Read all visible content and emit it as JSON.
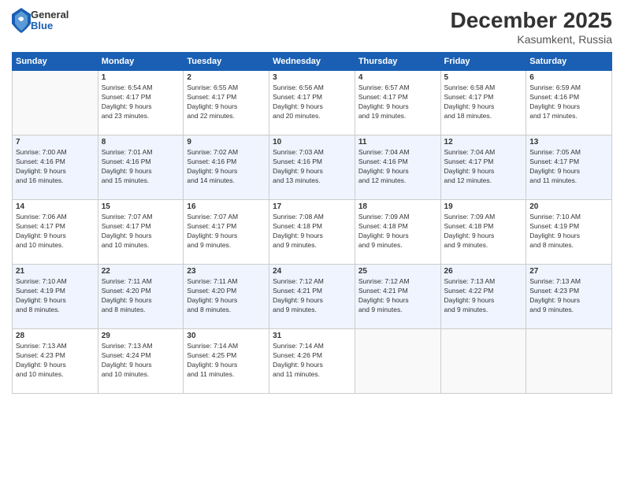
{
  "header": {
    "logo": {
      "line1": "General",
      "line2": "Blue"
    },
    "title": "December 2025",
    "location": "Kasumkent, Russia"
  },
  "weekdays": [
    "Sunday",
    "Monday",
    "Tuesday",
    "Wednesday",
    "Thursday",
    "Friday",
    "Saturday"
  ],
  "weeks": [
    [
      {
        "day": "",
        "info": ""
      },
      {
        "day": "1",
        "info": "Sunrise: 6:54 AM\nSunset: 4:17 PM\nDaylight: 9 hours\nand 23 minutes."
      },
      {
        "day": "2",
        "info": "Sunrise: 6:55 AM\nSunset: 4:17 PM\nDaylight: 9 hours\nand 22 minutes."
      },
      {
        "day": "3",
        "info": "Sunrise: 6:56 AM\nSunset: 4:17 PM\nDaylight: 9 hours\nand 20 minutes."
      },
      {
        "day": "4",
        "info": "Sunrise: 6:57 AM\nSunset: 4:17 PM\nDaylight: 9 hours\nand 19 minutes."
      },
      {
        "day": "5",
        "info": "Sunrise: 6:58 AM\nSunset: 4:17 PM\nDaylight: 9 hours\nand 18 minutes."
      },
      {
        "day": "6",
        "info": "Sunrise: 6:59 AM\nSunset: 4:16 PM\nDaylight: 9 hours\nand 17 minutes."
      }
    ],
    [
      {
        "day": "7",
        "info": "Sunrise: 7:00 AM\nSunset: 4:16 PM\nDaylight: 9 hours\nand 16 minutes."
      },
      {
        "day": "8",
        "info": "Sunrise: 7:01 AM\nSunset: 4:16 PM\nDaylight: 9 hours\nand 15 minutes."
      },
      {
        "day": "9",
        "info": "Sunrise: 7:02 AM\nSunset: 4:16 PM\nDaylight: 9 hours\nand 14 minutes."
      },
      {
        "day": "10",
        "info": "Sunrise: 7:03 AM\nSunset: 4:16 PM\nDaylight: 9 hours\nand 13 minutes."
      },
      {
        "day": "11",
        "info": "Sunrise: 7:04 AM\nSunset: 4:16 PM\nDaylight: 9 hours\nand 12 minutes."
      },
      {
        "day": "12",
        "info": "Sunrise: 7:04 AM\nSunset: 4:17 PM\nDaylight: 9 hours\nand 12 minutes."
      },
      {
        "day": "13",
        "info": "Sunrise: 7:05 AM\nSunset: 4:17 PM\nDaylight: 9 hours\nand 11 minutes."
      }
    ],
    [
      {
        "day": "14",
        "info": "Sunrise: 7:06 AM\nSunset: 4:17 PM\nDaylight: 9 hours\nand 10 minutes."
      },
      {
        "day": "15",
        "info": "Sunrise: 7:07 AM\nSunset: 4:17 PM\nDaylight: 9 hours\nand 10 minutes."
      },
      {
        "day": "16",
        "info": "Sunrise: 7:07 AM\nSunset: 4:17 PM\nDaylight: 9 hours\nand 9 minutes."
      },
      {
        "day": "17",
        "info": "Sunrise: 7:08 AM\nSunset: 4:18 PM\nDaylight: 9 hours\nand 9 minutes."
      },
      {
        "day": "18",
        "info": "Sunrise: 7:09 AM\nSunset: 4:18 PM\nDaylight: 9 hours\nand 9 minutes."
      },
      {
        "day": "19",
        "info": "Sunrise: 7:09 AM\nSunset: 4:18 PM\nDaylight: 9 hours\nand 9 minutes."
      },
      {
        "day": "20",
        "info": "Sunrise: 7:10 AM\nSunset: 4:19 PM\nDaylight: 9 hours\nand 8 minutes."
      }
    ],
    [
      {
        "day": "21",
        "info": "Sunrise: 7:10 AM\nSunset: 4:19 PM\nDaylight: 9 hours\nand 8 minutes."
      },
      {
        "day": "22",
        "info": "Sunrise: 7:11 AM\nSunset: 4:20 PM\nDaylight: 9 hours\nand 8 minutes."
      },
      {
        "day": "23",
        "info": "Sunrise: 7:11 AM\nSunset: 4:20 PM\nDaylight: 9 hours\nand 8 minutes."
      },
      {
        "day": "24",
        "info": "Sunrise: 7:12 AM\nSunset: 4:21 PM\nDaylight: 9 hours\nand 9 minutes."
      },
      {
        "day": "25",
        "info": "Sunrise: 7:12 AM\nSunset: 4:21 PM\nDaylight: 9 hours\nand 9 minutes."
      },
      {
        "day": "26",
        "info": "Sunrise: 7:13 AM\nSunset: 4:22 PM\nDaylight: 9 hours\nand 9 minutes."
      },
      {
        "day": "27",
        "info": "Sunrise: 7:13 AM\nSunset: 4:23 PM\nDaylight: 9 hours\nand 9 minutes."
      }
    ],
    [
      {
        "day": "28",
        "info": "Sunrise: 7:13 AM\nSunset: 4:23 PM\nDaylight: 9 hours\nand 10 minutes."
      },
      {
        "day": "29",
        "info": "Sunrise: 7:13 AM\nSunset: 4:24 PM\nDaylight: 9 hours\nand 10 minutes."
      },
      {
        "day": "30",
        "info": "Sunrise: 7:14 AM\nSunset: 4:25 PM\nDaylight: 9 hours\nand 11 minutes."
      },
      {
        "day": "31",
        "info": "Sunrise: 7:14 AM\nSunset: 4:26 PM\nDaylight: 9 hours\nand 11 minutes."
      },
      {
        "day": "",
        "info": ""
      },
      {
        "day": "",
        "info": ""
      },
      {
        "day": "",
        "info": ""
      }
    ]
  ]
}
